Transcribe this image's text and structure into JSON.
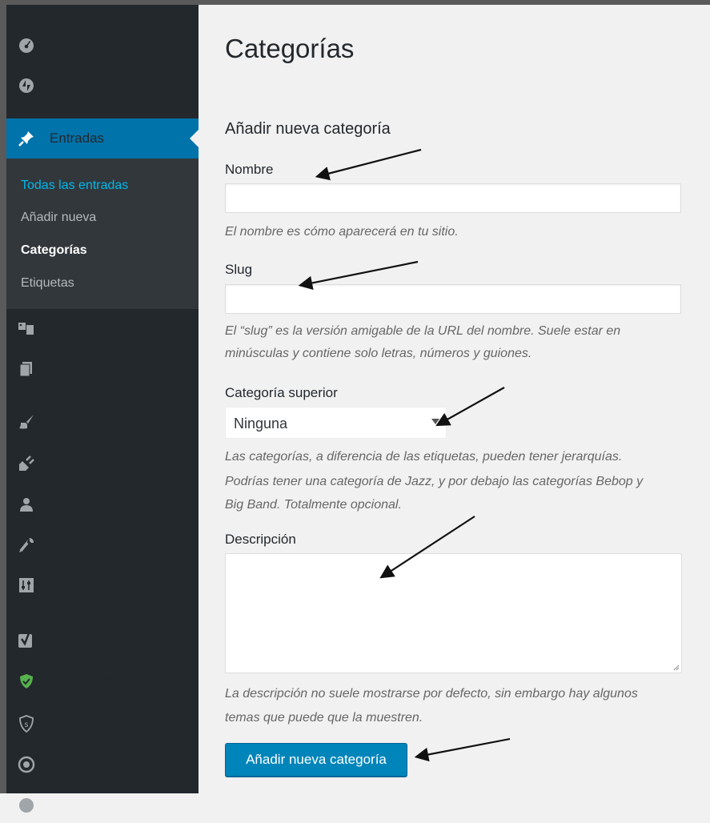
{
  "sidebar": {
    "items": [
      {
        "label": "Escritorio",
        "icon": "dashboard-icon"
      },
      {
        "label": "Jetpack",
        "icon": "jetpack-icon"
      },
      {
        "label": "Entradas",
        "icon": "pin-icon",
        "active": true
      },
      {
        "label": "Medios",
        "icon": "media-icon"
      },
      {
        "label": "Páginas",
        "icon": "pages-icon"
      },
      {
        "label": "Apariencia",
        "icon": "brush-icon"
      },
      {
        "label": "Plugins",
        "icon": "plug-icon"
      },
      {
        "label": "Usuarios",
        "icon": "user-icon"
      },
      {
        "label": "Herramientas",
        "icon": "wrench-icon"
      },
      {
        "label": "Ajustes",
        "icon": "settings-icon"
      },
      {
        "label": "SEO",
        "icon": "yoast-icon"
      },
      {
        "label": "Seguridad WP",
        "icon": "shield-icon"
      },
      {
        "label": "Sucuri Security",
        "icon": "sucuri-icon"
      },
      {
        "label": "WP-Optimize",
        "icon": "wp-optimize-icon"
      }
    ],
    "submenu": [
      {
        "label": "Todas las entradas",
        "state": "hover"
      },
      {
        "label": "Añadir nueva"
      },
      {
        "label": "Categorías",
        "state": "current"
      },
      {
        "label": "Etiquetas"
      }
    ]
  },
  "page": {
    "title": "Categorías",
    "form_title": "Añadir nueva categoría",
    "name_label": "Nombre",
    "name_value": "",
    "name_help": "El nombre es cómo aparecerá en tu sitio.",
    "slug_label": "Slug",
    "slug_value": "",
    "slug_help_1": "El “slug” es la versión amigable de la URL del nombre. Suele estar en",
    "slug_help_2": "minúsculas y contiene solo letras, números y guiones.",
    "parent_label": "Categoría superior",
    "parent_value": "Ninguna",
    "parent_help_1": "Las categorías, a diferencia de las etiquetas, pueden tener jerarquías.",
    "parent_help_2": "Podrías tener una categoría de Jazz, y por debajo las categorías Bebop y",
    "parent_help_3": "Big Band. Totalmente opcional.",
    "desc_label": "Descripción",
    "desc_value": "",
    "desc_help_1": "La descripción no suele mostrarse por defecto, sin embargo hay algunos",
    "desc_help_2": "temas que puede que la muestren.",
    "submit_label": "Añadir nueva categoría"
  },
  "colors": {
    "sidebar_bg": "#23282d",
    "submenu_bg": "#32373c",
    "active_bg": "#0073aa",
    "button_bg": "#0085ba",
    "link_hover": "#00b9eb"
  }
}
